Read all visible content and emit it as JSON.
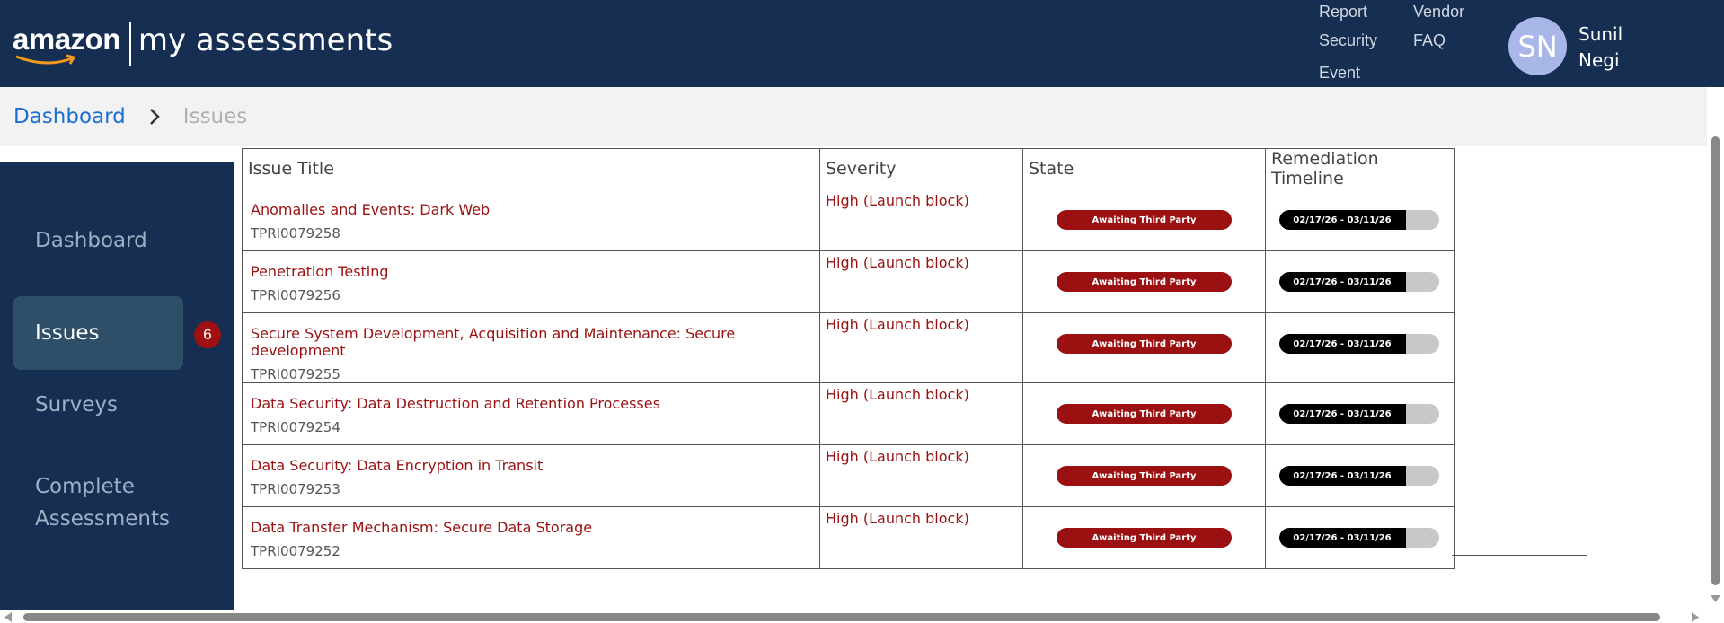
{
  "header": {
    "brand": "amazon",
    "app_title": "my assessments",
    "nav": [
      [
        "Report",
        "Security",
        "Event"
      ],
      [
        "Vendor",
        "FAQ"
      ]
    ],
    "user": {
      "initials": "SN",
      "first_name": "Sunil",
      "last_name": "Negi"
    }
  },
  "breadcrumb": {
    "root": "Dashboard",
    "current": "Issues"
  },
  "sidebar": {
    "items": [
      {
        "label": "Dashboard"
      },
      {
        "label": "Issues"
      },
      {
        "label": "Surveys"
      },
      {
        "label": "Complete\nAssessments"
      }
    ],
    "issues_badge": "6"
  },
  "table": {
    "headers": [
      "Issue Title",
      "Severity",
      "State",
      "Remediation Timeline"
    ],
    "rows": [
      {
        "title": "Anomalies and Events: Dark Web",
        "id": "TPRI0079258",
        "severity": "High (Launch block)",
        "state": "Awaiting Third Party",
        "timeline": "02/17/26 - 03/11/26",
        "progress": 0.79
      },
      {
        "title": "Penetration Testing",
        "id": "TPRI0079256",
        "severity": "High (Launch block)",
        "state": "Awaiting Third Party",
        "timeline": "02/17/26 - 03/11/26",
        "progress": 0.79
      },
      {
        "title": "Secure System Development, Acquisition and Maintenance: Secure development",
        "id": "TPRI0079255",
        "severity": "High (Launch block)",
        "state": "Awaiting Third Party",
        "timeline": "02/17/26 - 03/11/26",
        "progress": 0.79
      },
      {
        "title": "Data Security: Data Destruction and Retention Processes",
        "id": "TPRI0079254",
        "severity": "High (Launch block)",
        "state": "Awaiting Third Party",
        "timeline": "02/17/26 - 03/11/26",
        "progress": 0.79
      },
      {
        "title": "Data Security: Data Encryption in Transit",
        "id": "TPRI0079253",
        "severity": "High (Launch block)",
        "state": "Awaiting Third Party",
        "timeline": "02/17/26 - 03/11/26",
        "progress": 0.79
      },
      {
        "title": "Data Transfer Mechanism: Secure Data Storage",
        "id": "TPRI0079252",
        "severity": "High (Launch block)",
        "state": "Awaiting Third Party",
        "timeline": "02/17/26 - 03/11/26",
        "progress": 0.79
      }
    ]
  },
  "colors": {
    "header_bg": "#152e52",
    "accent_red": "#9b1010",
    "link_blue": "#1a6fd4"
  }
}
